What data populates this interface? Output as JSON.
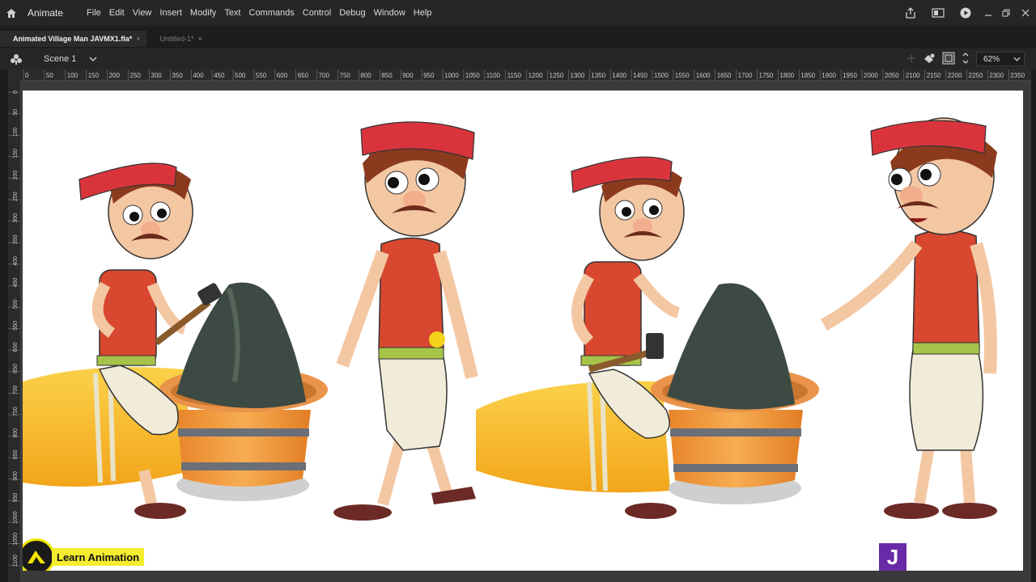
{
  "app": {
    "name": "Animate"
  },
  "menu": [
    "File",
    "Edit",
    "View",
    "Insert",
    "Modify",
    "Text",
    "Commands",
    "Control",
    "Debug",
    "Window",
    "Help"
  ],
  "tabs": [
    {
      "label": "Animated Village Man JAVMX1.fla*",
      "active": true
    },
    {
      "label": "Untitled-1*",
      "active": false
    }
  ],
  "scene": {
    "label": "Scene 1"
  },
  "zoom": {
    "value": "62%"
  },
  "ruler_h_labels": [
    "0",
    "50",
    "100",
    "150",
    "200",
    "250",
    "300",
    "350",
    "400",
    "450",
    "500",
    "550",
    "600",
    "650",
    "700",
    "750",
    "800",
    "850",
    "900",
    "950",
    "1000",
    "1050",
    "1100",
    "1150",
    "1200",
    "1250",
    "1300",
    "1350",
    "1400",
    "1450",
    "1500",
    "1550",
    "1600",
    "1650",
    "1700",
    "1750",
    "1800",
    "1850",
    "1900",
    "1950",
    "2000",
    "2050",
    "2100",
    "2150",
    "2200",
    "2250",
    "2300",
    "2350"
  ],
  "ruler_v_labels": [
    "0",
    "50",
    "100",
    "150",
    "200",
    "250",
    "300",
    "350",
    "400",
    "450",
    "500",
    "550",
    "600",
    "650",
    "700",
    "750",
    "800",
    "850",
    "900",
    "950",
    "1000",
    "1050",
    "1100"
  ],
  "watermark": {
    "text": "Learn Animation",
    "badge_letter": "J"
  },
  "colors": {
    "skin": "#f4c7a3",
    "headband": "#d9343c",
    "shirt": "#d8472f",
    "hair": "#8b3a1e",
    "pants": "#f1ebd9",
    "belt": "#a7c44a",
    "rock": "#3f4a44",
    "bucket": "#f29a3a",
    "straw": "#f6b521"
  }
}
